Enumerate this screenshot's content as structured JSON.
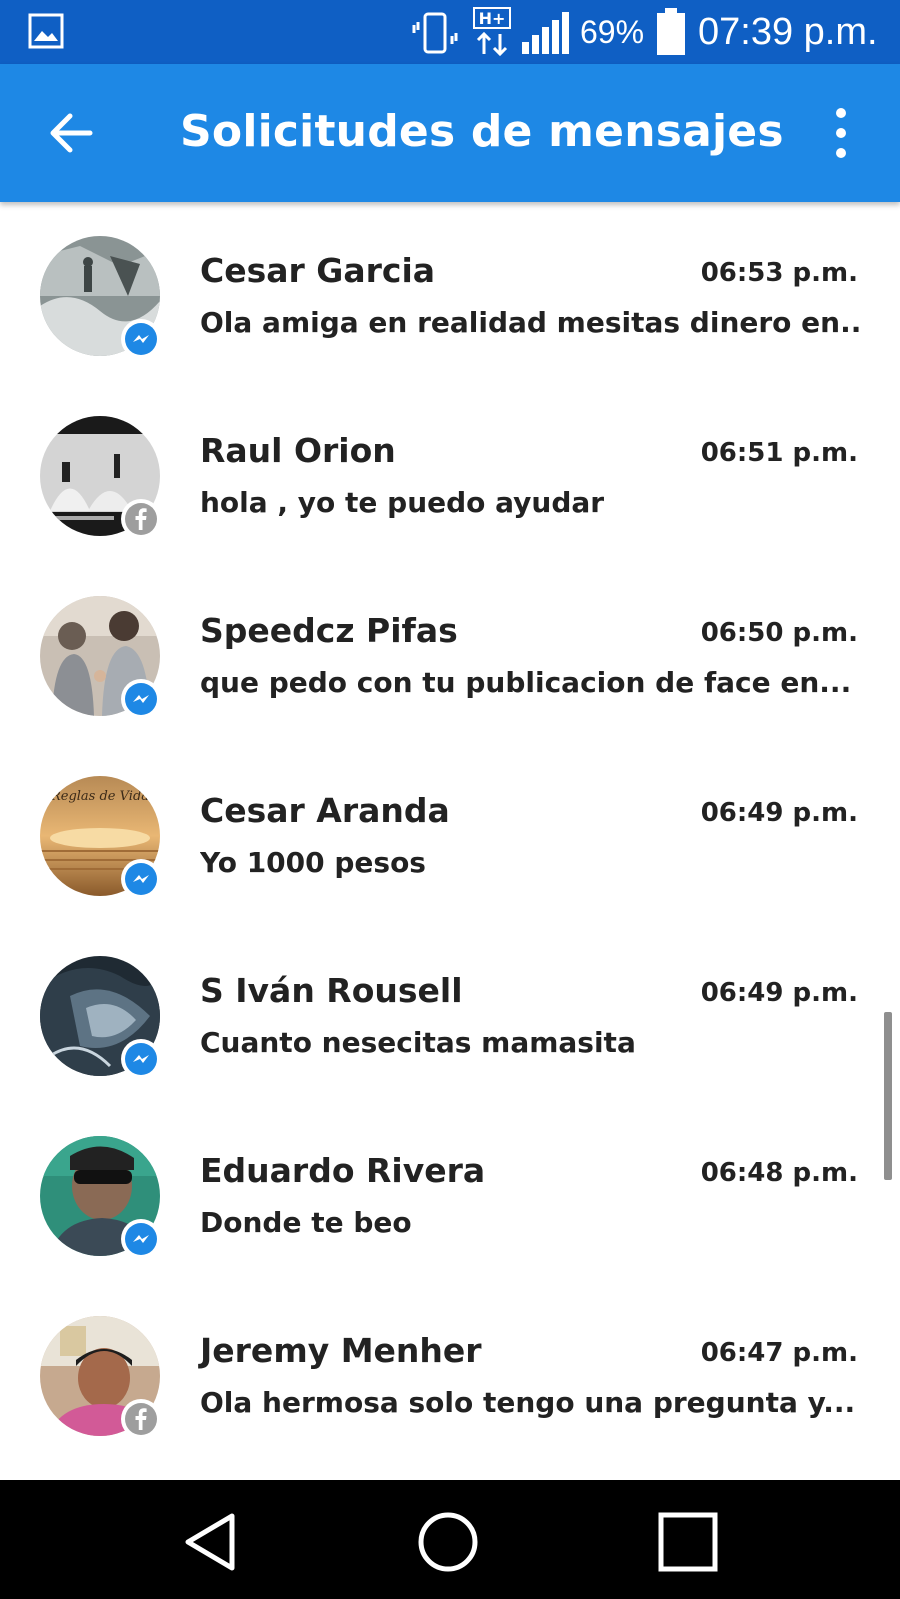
{
  "status_bar": {
    "battery_percent": "69%",
    "time": "07:39 p.m.",
    "network": "H+",
    "icons": [
      "gallery-icon",
      "vibrate-icon",
      "hplus-data-icon",
      "signal-icon",
      "battery-icon"
    ]
  },
  "app_bar": {
    "title": "Solicitudes de mensajes",
    "icons": [
      "back-arrow-icon",
      "more-vert-icon"
    ]
  },
  "conversations": [
    {
      "name": "Cesar Garcia",
      "time": "06:53 p.m.",
      "preview": "Ola amiga en realidad mesitas dinero en...",
      "badge": "messenger-icon"
    },
    {
      "name": "Raul Orion",
      "time": "06:51 p.m.",
      "preview": "hola , yo te puedo ayudar",
      "badge": "facebook-icon"
    },
    {
      "name": "Speedcz Pifas",
      "time": "06:50 p.m.",
      "preview": "que pedo con tu publicacion de face en...",
      "badge": "messenger-icon"
    },
    {
      "name": "Cesar Aranda",
      "time": "06:49 p.m.",
      "preview": "Yo 1000 pesos",
      "badge": "messenger-icon",
      "avatar_text": "Reglas de Vida"
    },
    {
      "name": "S Iván Rousell",
      "time": "06:49 p.m.",
      "preview": "Cuanto nesecitas mamasita",
      "badge": "messenger-icon"
    },
    {
      "name": "Eduardo Rivera",
      "time": "06:48 p.m.",
      "preview": "Donde te beo",
      "badge": "messenger-icon"
    },
    {
      "name": "Jeremy Menher",
      "time": "06:47 p.m.",
      "preview": "Ola hermosa solo tengo una pregunta y...",
      "badge": "facebook-icon"
    }
  ],
  "nav_bar": {
    "icons": [
      "nav-back-icon",
      "nav-home-icon",
      "nav-recents-icon"
    ]
  },
  "colors": {
    "status_bar": "#0f5fc4",
    "app_bar": "#1e88e5",
    "messenger_badge": "#1e88e5",
    "facebook_badge": "#9e9e9e",
    "text": "#222222"
  }
}
